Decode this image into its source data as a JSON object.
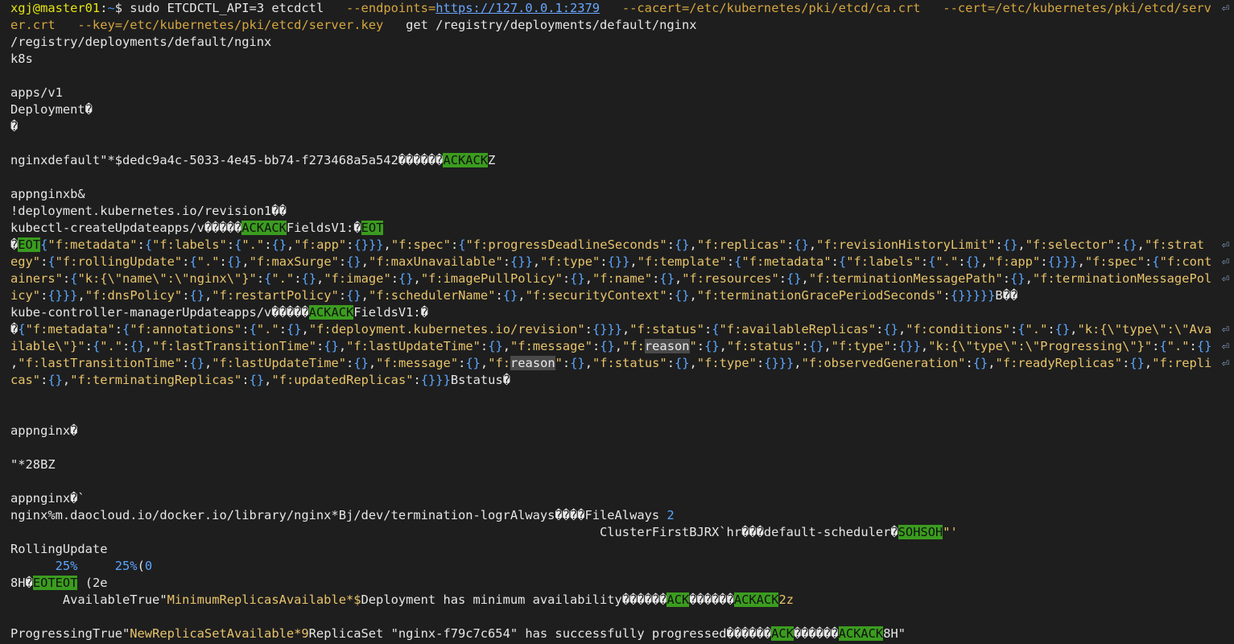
{
  "lines": [
    [
      [
        "xgj@master01",
        "prompt"
      ],
      [
        ":",
        "t"
      ],
      [
        "~",
        "path"
      ],
      [
        "$ sudo ETCDCTL_API=3 etcdctl   ",
        "t"
      ],
      [
        "--endpoints=",
        "opt"
      ],
      [
        "https://127.0.0.1:2379",
        "link"
      ],
      [
        "   --cacert=/etc/kubernetes/pki/etcd/ca.crt   --cert=/etc/kubernetes/pki/etcd/serv",
        "opt"
      ]
    ],
    [
      [
        "er.crt   --key=/etc/kubernetes/pki/etcd/server.key",
        "opt"
      ],
      [
        "   get /registry/deployments/default/nginx",
        "t"
      ]
    ],
    [
      [
        "/registry/deployments/default/nginx",
        "t"
      ]
    ],
    [
      [
        "k8s",
        "t"
      ]
    ],
    [],
    [
      [
        "apps/v1",
        "t"
      ]
    ],
    [
      [
        "Deployment�",
        "t"
      ]
    ],
    [
      [
        "�",
        "t"
      ]
    ],
    [],
    [
      [
        "nginxdefault\"*$dedc9a4c-5033-4e45-bb74-f273468a5a542������",
        "t"
      ],
      [
        "ACK",
        "ctrl"
      ],
      [
        "ACK",
        "ctrl"
      ],
      [
        "Z",
        "t"
      ]
    ],
    [],
    [
      [
        "appnginxb&",
        "t"
      ]
    ],
    [
      [
        "!deployment.kubernetes.io/revision1��",
        "t"
      ]
    ],
    [
      [
        "kubectl-createUpdateapps/v�����",
        "t"
      ],
      [
        "ACK",
        "ctrl"
      ],
      [
        "ACK",
        "ctrl"
      ],
      [
        "FieldsV1:�",
        "t"
      ],
      [
        "EOT",
        "ctrl"
      ]
    ],
    [
      [
        "�",
        "t"
      ],
      [
        "EOT",
        "ctrl"
      ],
      [
        "{",
        "brace"
      ],
      [
        "\"f:metadata\"",
        "str"
      ],
      [
        ":",
        "t"
      ],
      [
        "{",
        "brace"
      ],
      [
        "\"f:labels\"",
        "str"
      ],
      [
        ":",
        "t"
      ],
      [
        "{",
        "brace"
      ],
      [
        "\".\"",
        "str"
      ],
      [
        ":",
        "t"
      ],
      [
        "{}",
        "brace"
      ],
      [
        ",",
        "t"
      ],
      [
        "\"f:app\"",
        "str"
      ],
      [
        ":",
        "t"
      ],
      [
        "{}}}",
        "brace"
      ],
      [
        ",",
        "t"
      ],
      [
        "\"f:spec\"",
        "str"
      ],
      [
        ":",
        "t"
      ],
      [
        "{",
        "brace"
      ],
      [
        "\"f:progressDeadlineSeconds\"",
        "str"
      ],
      [
        ":",
        "t"
      ],
      [
        "{}",
        "brace"
      ],
      [
        ",",
        "t"
      ],
      [
        "\"f:replicas\"",
        "str"
      ],
      [
        ":",
        "t"
      ],
      [
        "{}",
        "brace"
      ],
      [
        ",",
        "t"
      ],
      [
        "\"f:revisionHistoryLimit\"",
        "str"
      ],
      [
        ":",
        "t"
      ],
      [
        "{}",
        "brace"
      ],
      [
        ",",
        "t"
      ],
      [
        "\"f:selector\"",
        "str"
      ],
      [
        ":",
        "t"
      ],
      [
        "{}",
        "brace"
      ],
      [
        ",",
        "t"
      ],
      [
        "\"f:strat",
        "str"
      ]
    ],
    [
      [
        "egy\"",
        "str"
      ],
      [
        ":",
        "t"
      ],
      [
        "{",
        "brace"
      ],
      [
        "\"f:rollingUpdate\"",
        "str"
      ],
      [
        ":",
        "t"
      ],
      [
        "{",
        "brace"
      ],
      [
        "\".\"",
        "str"
      ],
      [
        ":",
        "t"
      ],
      [
        "{}",
        "brace"
      ],
      [
        ",",
        "t"
      ],
      [
        "\"f:maxSurge\"",
        "str"
      ],
      [
        ":",
        "t"
      ],
      [
        "{}",
        "brace"
      ],
      [
        ",",
        "t"
      ],
      [
        "\"f:maxUnavailable\"",
        "str"
      ],
      [
        ":",
        "t"
      ],
      [
        "{}}",
        "brace"
      ],
      [
        ",",
        "t"
      ],
      [
        "\"f:type\"",
        "str"
      ],
      [
        ":",
        "t"
      ],
      [
        "{}}",
        "brace"
      ],
      [
        ",",
        "t"
      ],
      [
        "\"f:template\"",
        "str"
      ],
      [
        ":",
        "t"
      ],
      [
        "{",
        "brace"
      ],
      [
        "\"f:metadata\"",
        "str"
      ],
      [
        ":",
        "t"
      ],
      [
        "{",
        "brace"
      ],
      [
        "\"f:labels\"",
        "str"
      ],
      [
        ":",
        "t"
      ],
      [
        "{",
        "brace"
      ],
      [
        "\".\"",
        "str"
      ],
      [
        ":",
        "t"
      ],
      [
        "{}",
        "brace"
      ],
      [
        ",",
        "t"
      ],
      [
        "\"f:app\"",
        "str"
      ],
      [
        ":",
        "t"
      ],
      [
        "{}}}",
        "brace"
      ],
      [
        ",",
        "t"
      ],
      [
        "\"f:spec\"",
        "str"
      ],
      [
        ":",
        "t"
      ],
      [
        "{",
        "brace"
      ],
      [
        "\"f:cont",
        "str"
      ]
    ],
    [
      [
        "ainers\"",
        "str"
      ],
      [
        ":",
        "t"
      ],
      [
        "{",
        "brace"
      ],
      [
        "\"k:{\\\"name\\\":\\\"nginx\\\"}\"",
        "str"
      ],
      [
        ":",
        "t"
      ],
      [
        "{",
        "brace"
      ],
      [
        "\".\"",
        "str"
      ],
      [
        ":",
        "t"
      ],
      [
        "{}",
        "brace"
      ],
      [
        ",",
        "t"
      ],
      [
        "\"f:image\"",
        "str"
      ],
      [
        ":",
        "t"
      ],
      [
        "{}",
        "brace"
      ],
      [
        ",",
        "t"
      ],
      [
        "\"f:imagePullPolicy\"",
        "str"
      ],
      [
        ":",
        "t"
      ],
      [
        "{}",
        "brace"
      ],
      [
        ",",
        "t"
      ],
      [
        "\"f:name\"",
        "str"
      ],
      [
        ":",
        "t"
      ],
      [
        "{}",
        "brace"
      ],
      [
        ",",
        "t"
      ],
      [
        "\"f:resources\"",
        "str"
      ],
      [
        ":",
        "t"
      ],
      [
        "{}",
        "brace"
      ],
      [
        ",",
        "t"
      ],
      [
        "\"f:terminationMessagePath\"",
        "str"
      ],
      [
        ":",
        "t"
      ],
      [
        "{}",
        "brace"
      ],
      [
        ",",
        "t"
      ],
      [
        "\"f:terminationMessagePol",
        "str"
      ]
    ],
    [
      [
        "icy\"",
        "str"
      ],
      [
        ":",
        "t"
      ],
      [
        "{}}}",
        "brace"
      ],
      [
        ",",
        "t"
      ],
      [
        "\"f:dnsPolicy\"",
        "str"
      ],
      [
        ":",
        "t"
      ],
      [
        "{}",
        "brace"
      ],
      [
        ",",
        "t"
      ],
      [
        "\"f:restartPolicy\"",
        "str"
      ],
      [
        ":",
        "t"
      ],
      [
        "{}",
        "brace"
      ],
      [
        ",",
        "t"
      ],
      [
        "\"f:schedulerName\"",
        "str"
      ],
      [
        ":",
        "t"
      ],
      [
        "{}",
        "brace"
      ],
      [
        ",",
        "t"
      ],
      [
        "\"f:securityContext\"",
        "str"
      ],
      [
        ":",
        "t"
      ],
      [
        "{}",
        "brace"
      ],
      [
        ",",
        "t"
      ],
      [
        "\"f:terminationGracePeriodSeconds\"",
        "str"
      ],
      [
        ":",
        "t"
      ],
      [
        "{}}}}}",
        "brace"
      ],
      [
        "B��",
        "t"
      ]
    ],
    [
      [
        "kube-controller-managerUpdateapps/v�����",
        "t"
      ],
      [
        "ACK",
        "ctrl"
      ],
      [
        "ACK",
        "ctrl"
      ],
      [
        "FieldsV1:�",
        "t"
      ]
    ],
    [
      [
        "�",
        "t"
      ],
      [
        "{",
        "brace"
      ],
      [
        "\"f:metadata\"",
        "str"
      ],
      [
        ":",
        "t"
      ],
      [
        "{",
        "brace"
      ],
      [
        "\"f:annotations\"",
        "str"
      ],
      [
        ":",
        "t"
      ],
      [
        "{",
        "brace"
      ],
      [
        "\".\"",
        "str"
      ],
      [
        ":",
        "t"
      ],
      [
        "{}",
        "brace"
      ],
      [
        ",",
        "t"
      ],
      [
        "\"f:deployment.kubernetes.io/revision\"",
        "str"
      ],
      [
        ":",
        "t"
      ],
      [
        "{}}}",
        "brace"
      ],
      [
        ",",
        "t"
      ],
      [
        "\"f:status\"",
        "str"
      ],
      [
        ":",
        "t"
      ],
      [
        "{",
        "brace"
      ],
      [
        "\"f:availableReplicas\"",
        "str"
      ],
      [
        ":",
        "t"
      ],
      [
        "{}",
        "brace"
      ],
      [
        ",",
        "t"
      ],
      [
        "\"f:conditions\"",
        "str"
      ],
      [
        ":",
        "t"
      ],
      [
        "{",
        "brace"
      ],
      [
        "\".\"",
        "str"
      ],
      [
        ":",
        "t"
      ],
      [
        "{}",
        "brace"
      ],
      [
        ",",
        "t"
      ],
      [
        "\"k:{\\\"type\\\":\\\"Ava",
        "str"
      ]
    ],
    [
      [
        "ilable\\\"}\"",
        "str"
      ],
      [
        ":",
        "t"
      ],
      [
        "{",
        "brace"
      ],
      [
        "\".\"",
        "str"
      ],
      [
        ":",
        "t"
      ],
      [
        "{}",
        "brace"
      ],
      [
        ",",
        "t"
      ],
      [
        "\"f:lastTransitionTime\"",
        "str"
      ],
      [
        ":",
        "t"
      ],
      [
        "{}",
        "brace"
      ],
      [
        ",",
        "t"
      ],
      [
        "\"f:lastUpdateTime\"",
        "str"
      ],
      [
        ":",
        "t"
      ],
      [
        "{}",
        "brace"
      ],
      [
        ",",
        "t"
      ],
      [
        "\"f:message\"",
        "str"
      ],
      [
        ":",
        "t"
      ],
      [
        "{}",
        "brace"
      ],
      [
        ",",
        "t"
      ],
      [
        "\"f:",
        "str"
      ],
      [
        "reason",
        "hl"
      ],
      [
        "\"",
        "str"
      ],
      [
        ":",
        "t"
      ],
      [
        "{}",
        "brace"
      ],
      [
        ",",
        "t"
      ],
      [
        "\"f:status\"",
        "str"
      ],
      [
        ":",
        "t"
      ],
      [
        "{}",
        "brace"
      ],
      [
        ",",
        "t"
      ],
      [
        "\"f:type\"",
        "str"
      ],
      [
        ":",
        "t"
      ],
      [
        "{}}",
        "brace"
      ],
      [
        ",",
        "t"
      ],
      [
        "\"k:{\\\"type\\\":\\\"Progressing\\\"}\"",
        "str"
      ],
      [
        ":",
        "t"
      ],
      [
        "{",
        "brace"
      ],
      [
        "\".\"",
        "str"
      ],
      [
        ":",
        "t"
      ],
      [
        "{}",
        "brace"
      ]
    ],
    [
      [
        ",",
        "t"
      ],
      [
        "\"f:lastTransitionTime\"",
        "str"
      ],
      [
        ":",
        "t"
      ],
      [
        "{}",
        "brace"
      ],
      [
        ",",
        "t"
      ],
      [
        "\"f:lastUpdateTime\"",
        "str"
      ],
      [
        ":",
        "t"
      ],
      [
        "{}",
        "brace"
      ],
      [
        ",",
        "t"
      ],
      [
        "\"f:message\"",
        "str"
      ],
      [
        ":",
        "t"
      ],
      [
        "{}",
        "brace"
      ],
      [
        ",",
        "t"
      ],
      [
        "\"f:",
        "str"
      ],
      [
        "reason",
        "hl"
      ],
      [
        "\"",
        "str"
      ],
      [
        ":",
        "t"
      ],
      [
        "{}",
        "brace"
      ],
      [
        ",",
        "t"
      ],
      [
        "\"f:status\"",
        "str"
      ],
      [
        ":",
        "t"
      ],
      [
        "{}",
        "brace"
      ],
      [
        ",",
        "t"
      ],
      [
        "\"f:type\"",
        "str"
      ],
      [
        ":",
        "t"
      ],
      [
        "{}}}",
        "brace"
      ],
      [
        ",",
        "t"
      ],
      [
        "\"f:observedGeneration\"",
        "str"
      ],
      [
        ":",
        "t"
      ],
      [
        "{}",
        "brace"
      ],
      [
        ",",
        "t"
      ],
      [
        "\"f:readyReplicas\"",
        "str"
      ],
      [
        ":",
        "t"
      ],
      [
        "{}",
        "brace"
      ],
      [
        ",",
        "t"
      ],
      [
        "\"f:repli",
        "str"
      ]
    ],
    [
      [
        "cas\"",
        "str"
      ],
      [
        ":",
        "t"
      ],
      [
        "{}",
        "brace"
      ],
      [
        ",",
        "t"
      ],
      [
        "\"f:terminatingReplicas\"",
        "str"
      ],
      [
        ":",
        "t"
      ],
      [
        "{}",
        "brace"
      ],
      [
        ",",
        "t"
      ],
      [
        "\"f:updatedReplicas\"",
        "str"
      ],
      [
        ":",
        "t"
      ],
      [
        "{}}}",
        "brace"
      ],
      [
        "Bstatus�",
        "t"
      ]
    ],
    [],
    [],
    [
      [
        "appnginx�",
        "t"
      ]
    ],
    [],
    [
      [
        "\"*28BZ",
        "t"
      ]
    ],
    [],
    [
      [
        "appnginx�`",
        "t"
      ]
    ],
    [
      [
        "nginx%m.daocloud.io/docker.io/library/nginx*Bj/dev/termination-logrAlways����FileAlways ",
        "t"
      ],
      [
        "2",
        "brace"
      ]
    ],
    [
      [
        "                                                                               ClusterFirstBJRX`hr���default-scheduler�",
        "t"
      ],
      [
        "SOH",
        "ctrl"
      ],
      [
        "SOH",
        "ctrl"
      ],
      [
        "\"'",
        "str"
      ]
    ],
    [
      [
        "RollingUpdate",
        "t"
      ]
    ],
    [
      [
        "      ",
        "t"
      ],
      [
        "25%",
        "brace"
      ],
      [
        "     ",
        "t"
      ],
      [
        "25%",
        "brace"
      ],
      [
        "(",
        "t"
      ],
      [
        "0",
        "brace"
      ]
    ],
    [
      [
        "8H�",
        "t"
      ],
      [
        "EOT",
        "ctrl"
      ],
      [
        "EOT",
        "ctrl"
      ],
      [
        " (2e",
        "t"
      ]
    ],
    [
      [
        "       AvailableTrue\"",
        "t"
      ],
      [
        "MinimumReplicasAvailable*$",
        "str"
      ],
      [
        "Deployment has minimum availability������",
        "t"
      ],
      [
        "ACK",
        "ctrl"
      ],
      [
        "������",
        "t"
      ],
      [
        "ACK",
        "ctrl"
      ],
      [
        "ACK",
        "ctrl"
      ],
      [
        "2z",
        "str"
      ]
    ],
    [],
    [
      [
        "ProgressingTrue\"",
        "t"
      ],
      [
        "NewReplicaSetAvailable*9",
        "str"
      ],
      [
        "ReplicaSet \"nginx-f79c7c654\" has successfully progressed������",
        "t"
      ],
      [
        "ACK",
        "ctrl"
      ],
      [
        "������",
        "t"
      ],
      [
        "ACK",
        "ctrl"
      ],
      [
        "ACK",
        "ctrl"
      ],
      [
        "8H\"",
        "t"
      ]
    ]
  ],
  "wrap_marker": "⏎",
  "wrapped_lines": [
    0,
    14,
    15,
    16,
    19,
    20,
    21
  ]
}
